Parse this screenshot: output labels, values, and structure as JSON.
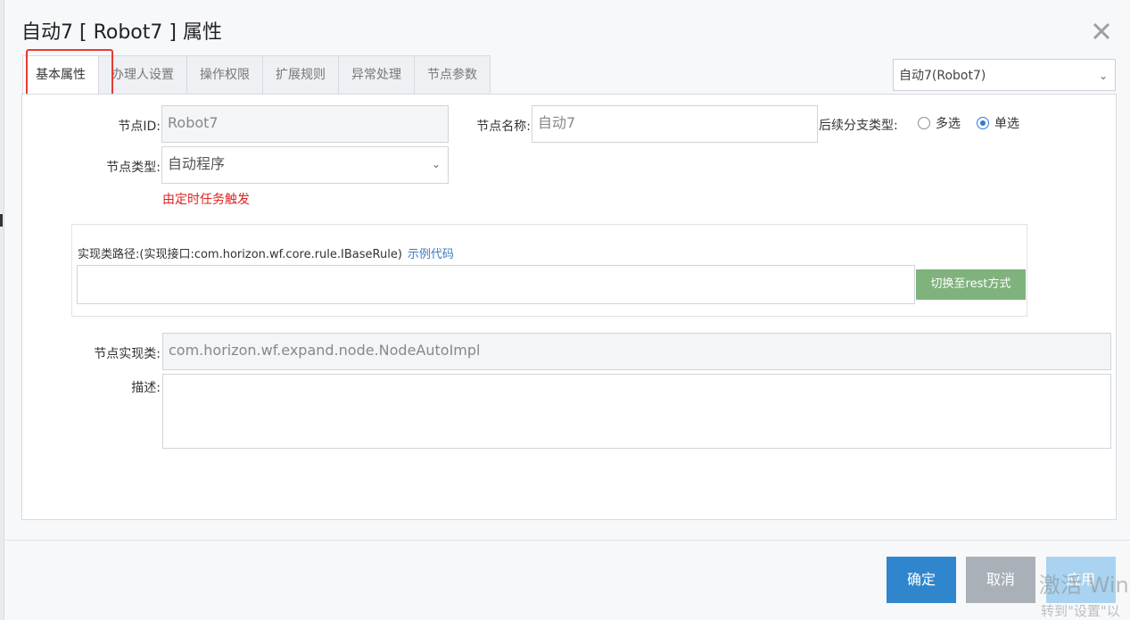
{
  "dialog": {
    "title": "自动7 [ Robot7 ] 属性"
  },
  "tabs": [
    {
      "label": "基本属性",
      "active": true
    },
    {
      "label": "办理人设置",
      "active": false
    },
    {
      "label": "操作权限",
      "active": false
    },
    {
      "label": "扩展规则",
      "active": false
    },
    {
      "label": "异常处理",
      "active": false
    },
    {
      "label": "节点参数",
      "active": false
    }
  ],
  "node_selector": {
    "value": "自动7(Robot7)"
  },
  "form": {
    "node_id_label": "节点ID:",
    "node_id_value": "Robot7",
    "node_name_label": "节点名称:",
    "node_name_value": "自动7",
    "branch_type_label": "后续分支类型:",
    "branch_options": [
      "多选",
      "单选"
    ],
    "branch_selected": "单选",
    "node_type_label": "节点类型:",
    "node_type_value": "自动程序",
    "node_type_hint": "由定时任务触发",
    "impl_caption": "实现类路径:(实现接口:com.horizon.wf.core.rule.IBaseRule)",
    "impl_example_link": "示例代码",
    "impl_path_value": "",
    "switch_button": "切换至rest方式",
    "impl_class_label": "节点实现类:",
    "impl_class_value": "com.horizon.wf.expand.node.NodeAutoImpl",
    "desc_label": "描述:",
    "desc_value": ""
  },
  "footer": {
    "ok": "确定",
    "cancel": "取消",
    "apply": "应用"
  },
  "watermark": {
    "line1": "激活 Win",
    "line2": "转到\"设置\"以"
  },
  "colors": {
    "primary": "#2f86cd",
    "highlight": "#e53b35",
    "switch_green": "#7fb27c",
    "hint_red": "#e02020"
  }
}
